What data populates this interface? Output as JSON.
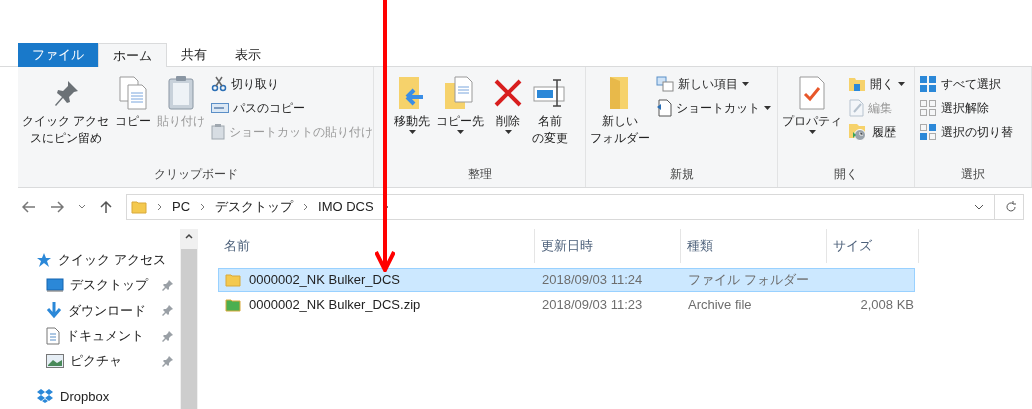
{
  "tabs": [
    {
      "label": "ファイル",
      "kind": "file",
      "selected": false
    },
    {
      "label": "ホーム",
      "kind": "tab",
      "selected": true
    },
    {
      "label": "共有",
      "kind": "tab",
      "selected": false
    },
    {
      "label": "表示",
      "kind": "tab",
      "selected": false
    }
  ],
  "ribbon": {
    "groups": [
      {
        "label": "クリップボード",
        "large": [
          {
            "lines": [
              "クイック アクセ",
              "スにピン留め"
            ],
            "disabled": false,
            "dropdown": false
          },
          {
            "lines": [
              "コピー"
            ],
            "disabled": false,
            "dropdown": false
          },
          {
            "lines": [
              "貼り付け"
            ],
            "disabled": true,
            "dropdown": false
          }
        ],
        "small": [
          {
            "label": "切り取り",
            "disabled": false,
            "dropdown": false
          },
          {
            "label": "パスのコピー",
            "disabled": false,
            "dropdown": false
          },
          {
            "label": "ショートカットの貼り付け",
            "disabled": true,
            "dropdown": false
          }
        ]
      },
      {
        "label": "整理",
        "large": [
          {
            "lines": [
              "移動先"
            ],
            "disabled": false,
            "dropdown": true
          },
          {
            "lines": [
              "コピー先"
            ],
            "disabled": false,
            "dropdown": true
          },
          {
            "lines": [
              "削除"
            ],
            "disabled": false,
            "dropdown": true
          },
          {
            "lines": [
              "名前",
              "の変更"
            ],
            "disabled": false,
            "dropdown": false
          }
        ]
      },
      {
        "label": "新規",
        "large": [
          {
            "lines": [
              "新しい",
              "フォルダー"
            ],
            "disabled": false,
            "dropdown": false
          }
        ],
        "small": [
          {
            "label": "新しい項目",
            "disabled": false,
            "dropdown": true
          },
          {
            "label": "ショートカット",
            "disabled": false,
            "dropdown": true
          }
        ]
      },
      {
        "label": "開く",
        "large": [
          {
            "lines": [
              "プロパティ"
            ],
            "disabled": false,
            "dropdown": true
          }
        ],
        "small": [
          {
            "label": "開く",
            "disabled": false,
            "dropdown": true
          },
          {
            "label": "編集",
            "disabled": true,
            "dropdown": false
          },
          {
            "label": "履歴",
            "disabled": false,
            "dropdown": false
          }
        ]
      },
      {
        "label": "選択",
        "small": [
          {
            "label": "すべて選択",
            "disabled": false,
            "dropdown": false
          },
          {
            "label": "選択解除",
            "disabled": false,
            "dropdown": false
          },
          {
            "label": "選択の切り替",
            "disabled": false,
            "dropdown": false
          }
        ]
      }
    ]
  },
  "address": {
    "path": [
      "PC",
      "デスクトップ",
      "IMO DCS"
    ]
  },
  "navigation": [
    {
      "kind": "quick",
      "label": "クイック アクセス",
      "pinned": false
    },
    {
      "kind": "desktop",
      "label": "デスクトップ",
      "pinned": true
    },
    {
      "kind": "download",
      "label": "ダウンロード",
      "pinned": true
    },
    {
      "kind": "document",
      "label": "ドキュメント",
      "pinned": true
    },
    {
      "kind": "picture",
      "label": "ピクチャ",
      "pinned": true
    },
    {
      "kind": "dropbox",
      "label": "Dropbox",
      "pinned": false
    }
  ],
  "table": {
    "columns": [
      "名前",
      "更新日時",
      "種類",
      "サイズ"
    ],
    "rows": [
      {
        "kind": "folder",
        "name": "0000002_NK Bulker_DCS",
        "modified": "2018/09/03 11:24",
        "type": "ファイル フォルダー",
        "selected": true
      },
      {
        "kind": "zip",
        "name": "0000002_NK Bulker_DCS.zip",
        "modified": "2018/09/03 11:23",
        "type": "Archive file",
        "size": "2,008 KB",
        "selected": false
      }
    ]
  }
}
